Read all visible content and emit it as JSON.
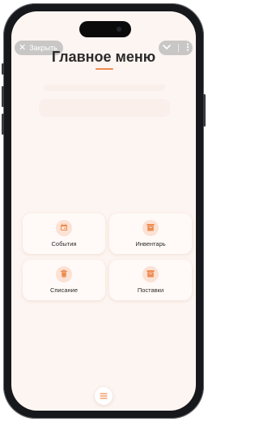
{
  "top_bar": {
    "close_label": "Закрыть",
    "close_icon": "close-icon",
    "chevron_icon": "chevron-down-icon",
    "more_icon": "more-vertical-icon"
  },
  "page": {
    "title": "Главное меню"
  },
  "cards": [
    {
      "label": "События",
      "icon": "calendar-icon"
    },
    {
      "label": "Инвентарь",
      "icon": "archive-box-icon"
    },
    {
      "label": "Списание",
      "icon": "trash-icon"
    },
    {
      "label": "Поставки",
      "icon": "archive-box-icon"
    }
  ],
  "bottom": {
    "menu_icon": "hamburger-menu-icon"
  },
  "colors": {
    "accent": "#ee8b4f",
    "background": "#fdf5f1"
  }
}
